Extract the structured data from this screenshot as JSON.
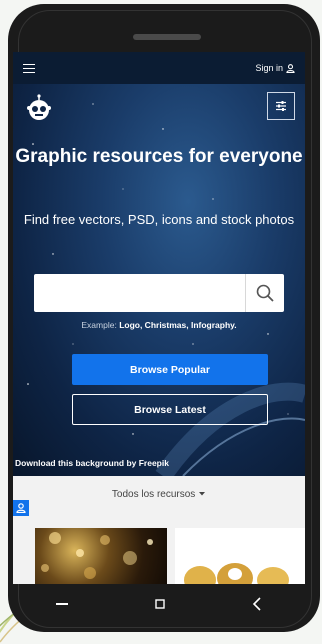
{
  "topbar": {
    "signin_label": "Sign in"
  },
  "hero": {
    "title": "Graphic resources for everyone",
    "subtitle": "Find free vectors, PSD, icons and stock photos",
    "search": {
      "value": "",
      "placeholder": ""
    },
    "example_prefix": "Example:",
    "examples": "Logo, Christmas, Infography.",
    "browse_popular_label": "Browse Popular",
    "browse_latest_label": "Browse Latest",
    "credit": "Download this background by Freepik"
  },
  "lower": {
    "resources_label": "Todos los recursos"
  },
  "icons": {
    "menu": "hamburger-icon",
    "user": "user-icon",
    "logo": "robot-logo",
    "filter": "sliders-icon",
    "search": "search-icon",
    "caret": "caret-down-icon",
    "nav_recent": "recent-apps-icon",
    "nav_home": "home-square-icon",
    "nav_back": "back-chevron-icon"
  },
  "colors": {
    "accent": "#1273eb",
    "topbar": "#0b1c33",
    "hero_dark": "#0e2445"
  }
}
